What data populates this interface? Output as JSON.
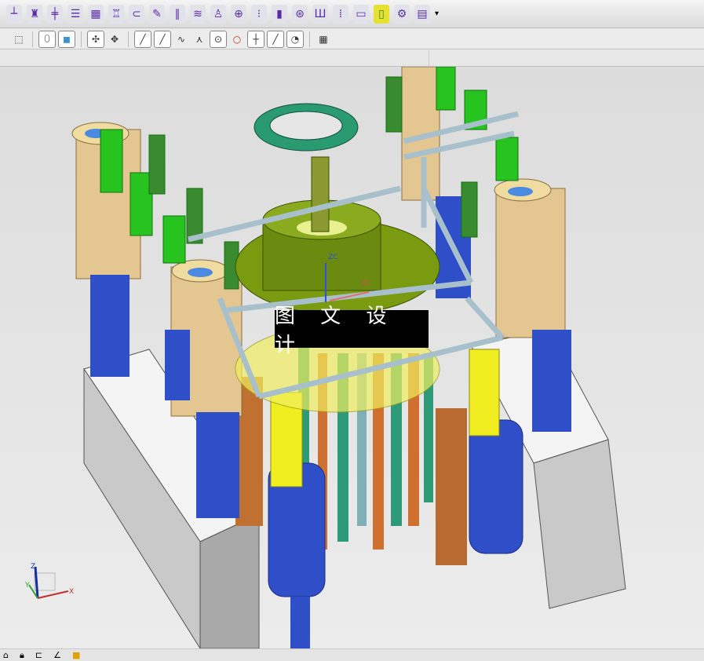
{
  "toolbar_row1": {
    "icons": [
      "ejector-pin-icon",
      "slider-icon",
      "lifter-icon",
      "mold-base-icon",
      "cavity-layout-icon",
      "standard-part-icon",
      "sub-insert-icon",
      "electrode-icon",
      "gate-icon",
      "spring-icon",
      "screw-icon",
      "locating-ring-icon",
      "pocket-icon",
      "cooling-icon",
      "runner-icon",
      "support-pillar-icon",
      "insert-icon",
      "parting-icon",
      "sprue-icon",
      "settings-icon",
      "drawing-icon"
    ],
    "overflow": "more-icon"
  },
  "toolbar_row2": {
    "icons": [
      "select-rect-icon",
      "shaded-edge-icon",
      "shaded-icon",
      "snap-point-icon",
      "point-set-icon",
      "endpoint-icon",
      "midpoint-icon",
      "control-point-icon",
      "intersection-icon",
      "arc-center-icon",
      "quadrant-icon",
      "existing-point-icon",
      "point-on-curve-icon",
      "point-on-face-icon",
      "grid-icon"
    ]
  },
  "viewport": {
    "watermark": "图 文 设 计",
    "wcs_labels": {
      "z": "ZC",
      "x": "XC"
    },
    "triad": {
      "x": "X",
      "y": "Y",
      "z": "Z"
    },
    "colors": {
      "background": "#e6e6e6",
      "plate": "#f2f2f2",
      "tan": "#e3c690",
      "blue": "#2f4fc8",
      "green": "#27c41f",
      "yellow": "#f0ee20",
      "orange": "#cf7030",
      "olive": "#7a9a10",
      "teal": "#2e9a78"
    }
  }
}
